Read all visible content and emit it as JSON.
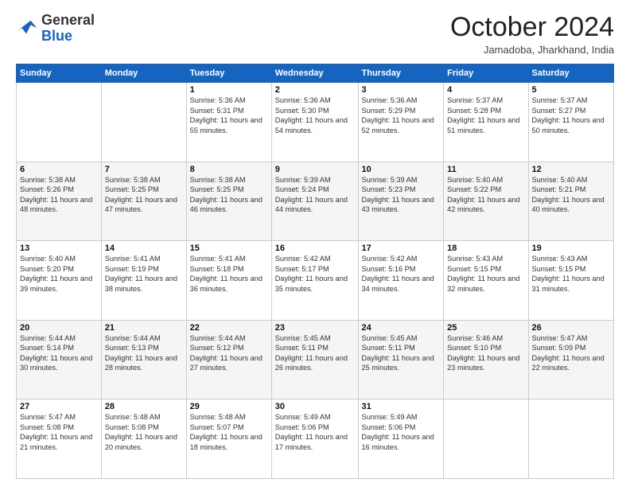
{
  "logo": {
    "general": "General",
    "blue": "Blue"
  },
  "header": {
    "month": "October 2024",
    "location": "Jamadoba, Jharkhand, India"
  },
  "days_of_week": [
    "Sunday",
    "Monday",
    "Tuesday",
    "Wednesday",
    "Thursday",
    "Friday",
    "Saturday"
  ],
  "weeks": [
    [
      {
        "day": "",
        "sunrise": "",
        "sunset": "",
        "daylight": ""
      },
      {
        "day": "",
        "sunrise": "",
        "sunset": "",
        "daylight": ""
      },
      {
        "day": "1",
        "sunrise": "Sunrise: 5:36 AM",
        "sunset": "Sunset: 5:31 PM",
        "daylight": "Daylight: 11 hours and 55 minutes."
      },
      {
        "day": "2",
        "sunrise": "Sunrise: 5:36 AM",
        "sunset": "Sunset: 5:30 PM",
        "daylight": "Daylight: 11 hours and 54 minutes."
      },
      {
        "day": "3",
        "sunrise": "Sunrise: 5:36 AM",
        "sunset": "Sunset: 5:29 PM",
        "daylight": "Daylight: 11 hours and 52 minutes."
      },
      {
        "day": "4",
        "sunrise": "Sunrise: 5:37 AM",
        "sunset": "Sunset: 5:28 PM",
        "daylight": "Daylight: 11 hours and 51 minutes."
      },
      {
        "day": "5",
        "sunrise": "Sunrise: 5:37 AM",
        "sunset": "Sunset: 5:27 PM",
        "daylight": "Daylight: 11 hours and 50 minutes."
      }
    ],
    [
      {
        "day": "6",
        "sunrise": "Sunrise: 5:38 AM",
        "sunset": "Sunset: 5:26 PM",
        "daylight": "Daylight: 11 hours and 48 minutes."
      },
      {
        "day": "7",
        "sunrise": "Sunrise: 5:38 AM",
        "sunset": "Sunset: 5:25 PM",
        "daylight": "Daylight: 11 hours and 47 minutes."
      },
      {
        "day": "8",
        "sunrise": "Sunrise: 5:38 AM",
        "sunset": "Sunset: 5:25 PM",
        "daylight": "Daylight: 11 hours and 46 minutes."
      },
      {
        "day": "9",
        "sunrise": "Sunrise: 5:39 AM",
        "sunset": "Sunset: 5:24 PM",
        "daylight": "Daylight: 11 hours and 44 minutes."
      },
      {
        "day": "10",
        "sunrise": "Sunrise: 5:39 AM",
        "sunset": "Sunset: 5:23 PM",
        "daylight": "Daylight: 11 hours and 43 minutes."
      },
      {
        "day": "11",
        "sunrise": "Sunrise: 5:40 AM",
        "sunset": "Sunset: 5:22 PM",
        "daylight": "Daylight: 11 hours and 42 minutes."
      },
      {
        "day": "12",
        "sunrise": "Sunrise: 5:40 AM",
        "sunset": "Sunset: 5:21 PM",
        "daylight": "Daylight: 11 hours and 40 minutes."
      }
    ],
    [
      {
        "day": "13",
        "sunrise": "Sunrise: 5:40 AM",
        "sunset": "Sunset: 5:20 PM",
        "daylight": "Daylight: 11 hours and 39 minutes."
      },
      {
        "day": "14",
        "sunrise": "Sunrise: 5:41 AM",
        "sunset": "Sunset: 5:19 PM",
        "daylight": "Daylight: 11 hours and 38 minutes."
      },
      {
        "day": "15",
        "sunrise": "Sunrise: 5:41 AM",
        "sunset": "Sunset: 5:18 PM",
        "daylight": "Daylight: 11 hours and 36 minutes."
      },
      {
        "day": "16",
        "sunrise": "Sunrise: 5:42 AM",
        "sunset": "Sunset: 5:17 PM",
        "daylight": "Daylight: 11 hours and 35 minutes."
      },
      {
        "day": "17",
        "sunrise": "Sunrise: 5:42 AM",
        "sunset": "Sunset: 5:16 PM",
        "daylight": "Daylight: 11 hours and 34 minutes."
      },
      {
        "day": "18",
        "sunrise": "Sunrise: 5:43 AM",
        "sunset": "Sunset: 5:15 PM",
        "daylight": "Daylight: 11 hours and 32 minutes."
      },
      {
        "day": "19",
        "sunrise": "Sunrise: 5:43 AM",
        "sunset": "Sunset: 5:15 PM",
        "daylight": "Daylight: 11 hours and 31 minutes."
      }
    ],
    [
      {
        "day": "20",
        "sunrise": "Sunrise: 5:44 AM",
        "sunset": "Sunset: 5:14 PM",
        "daylight": "Daylight: 11 hours and 30 minutes."
      },
      {
        "day": "21",
        "sunrise": "Sunrise: 5:44 AM",
        "sunset": "Sunset: 5:13 PM",
        "daylight": "Daylight: 11 hours and 28 minutes."
      },
      {
        "day": "22",
        "sunrise": "Sunrise: 5:44 AM",
        "sunset": "Sunset: 5:12 PM",
        "daylight": "Daylight: 11 hours and 27 minutes."
      },
      {
        "day": "23",
        "sunrise": "Sunrise: 5:45 AM",
        "sunset": "Sunset: 5:11 PM",
        "daylight": "Daylight: 11 hours and 26 minutes."
      },
      {
        "day": "24",
        "sunrise": "Sunrise: 5:45 AM",
        "sunset": "Sunset: 5:11 PM",
        "daylight": "Daylight: 11 hours and 25 minutes."
      },
      {
        "day": "25",
        "sunrise": "Sunrise: 5:46 AM",
        "sunset": "Sunset: 5:10 PM",
        "daylight": "Daylight: 11 hours and 23 minutes."
      },
      {
        "day": "26",
        "sunrise": "Sunrise: 5:47 AM",
        "sunset": "Sunset: 5:09 PM",
        "daylight": "Daylight: 11 hours and 22 minutes."
      }
    ],
    [
      {
        "day": "27",
        "sunrise": "Sunrise: 5:47 AM",
        "sunset": "Sunset: 5:08 PM",
        "daylight": "Daylight: 11 hours and 21 minutes."
      },
      {
        "day": "28",
        "sunrise": "Sunrise: 5:48 AM",
        "sunset": "Sunset: 5:08 PM",
        "daylight": "Daylight: 11 hours and 20 minutes."
      },
      {
        "day": "29",
        "sunrise": "Sunrise: 5:48 AM",
        "sunset": "Sunset: 5:07 PM",
        "daylight": "Daylight: 11 hours and 18 minutes."
      },
      {
        "day": "30",
        "sunrise": "Sunrise: 5:49 AM",
        "sunset": "Sunset: 5:06 PM",
        "daylight": "Daylight: 11 hours and 17 minutes."
      },
      {
        "day": "31",
        "sunrise": "Sunrise: 5:49 AM",
        "sunset": "Sunset: 5:06 PM",
        "daylight": "Daylight: 11 hours and 16 minutes."
      },
      {
        "day": "",
        "sunrise": "",
        "sunset": "",
        "daylight": ""
      },
      {
        "day": "",
        "sunrise": "",
        "sunset": "",
        "daylight": ""
      }
    ]
  ]
}
